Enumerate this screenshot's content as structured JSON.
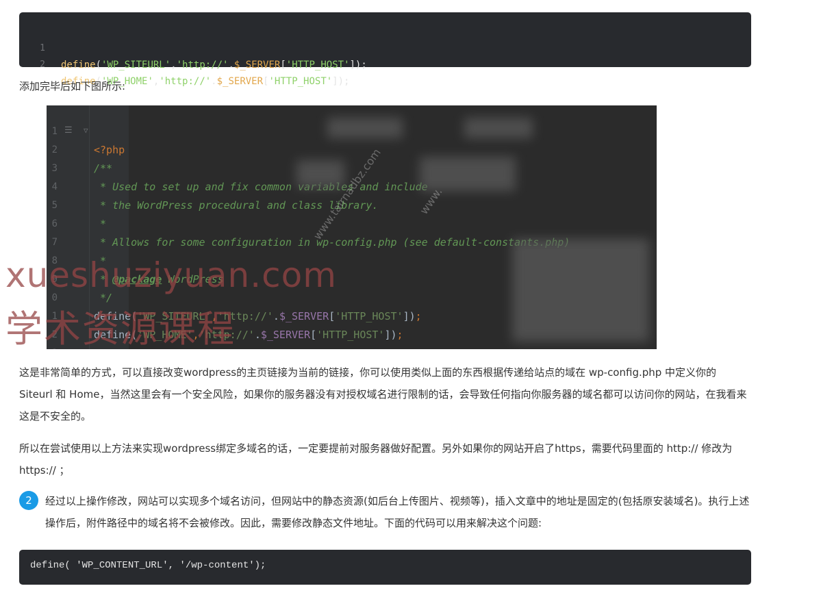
{
  "code_block_1": {
    "lines": [
      {
        "num": "1",
        "fn": "define",
        "open": "(",
        "arg1": "'WP_SITEURL'",
        "comma": ",",
        "arg2a": "'http://'",
        "dot": ".",
        "var": "$_SERVER",
        "br_open": "[",
        "key": "'HTTP_HOST'",
        "close": "]);"
      },
      {
        "num": "2",
        "fn": "define",
        "open": "(",
        "arg1": "'WP_HOME'",
        "comma": ",",
        "arg2a": "'http://'",
        "dot": ".",
        "var": "$_SERVER",
        "br_open": "[",
        "key": "'HTTP_HOST'",
        "close": "]);"
      }
    ]
  },
  "caption_after_code": "添加完毕后如下图所示:",
  "ide": {
    "lines": [
      {
        "num": "1",
        "text": "<?php"
      },
      {
        "num": "2",
        "text": "/**"
      },
      {
        "num": "3",
        "text": " * Used to set up and fix common variables and include"
      },
      {
        "num": "4",
        "text": " * the WordPress procedural and class library."
      },
      {
        "num": "5",
        "text": " *"
      },
      {
        "num": "6",
        "text": " * Allows for some configuration in wp-config.php (see default-constants.php)"
      },
      {
        "num": "7",
        "text": " *"
      },
      {
        "num": "8",
        "tag": "@package",
        "text": " WordPress"
      },
      {
        "num": "9",
        "text": " */"
      },
      {
        "num": "0",
        "fn": "define",
        "arg1": "'WP_SITEURL'",
        "arg2": "'http://'",
        "var": "$_SERVER",
        "key": "'HTTP_HOST'"
      },
      {
        "num": "1",
        "fn": "define",
        "arg1": "'WP_HOME'",
        "arg2": "'http://'",
        "var": "$_SERVER",
        "key": "'HTTP_HOST'"
      },
      {
        "num": "2",
        "text": ""
      },
      {
        "num": "3",
        "text": "/**"
      }
    ],
    "watermarks": [
      "www.tairnadbz.com",
      "www."
    ]
  },
  "watermark": {
    "line1": "xueshuziyuan.com",
    "line2": "学术资源课程"
  },
  "paragraph_1": "这是非常简单的方式，可以直接改变wordpress的主页链接为当前的链接，你可以使用类似上面的东西根据传递给站点的域在 wp-config.php 中定义你的 Siteurl 和 Home，当然这里会有一个安全风险，如果你的服务器没有对授权域名进行限制的话，会导致任何指向你服务器的域名都可以访问你的网站，在我看来这是不安全的。",
  "paragraph_2": "所以在尝试使用以上方法来实现wordpress绑定多域名的话，一定要提前对服务器做好配置。另外如果你的网站开启了https，需要代码里面的 http:// 修改为 https:// ；",
  "step": {
    "number": "2",
    "text": "经过以上操作修改，网站可以实现多个域名访问，但网站中的静态资源(如后台上传图片、视频等)，插入文章中的地址是固定的(包括原安装域名)。执行上述操作后，附件路径中的域名将不会被修改。因此，需要修改静态文件地址。下面的代码可以用来解决这个问题:"
  },
  "code_block_2": {
    "text": "define( 'WP_CONTENT_URL', '/wp-content');"
  }
}
